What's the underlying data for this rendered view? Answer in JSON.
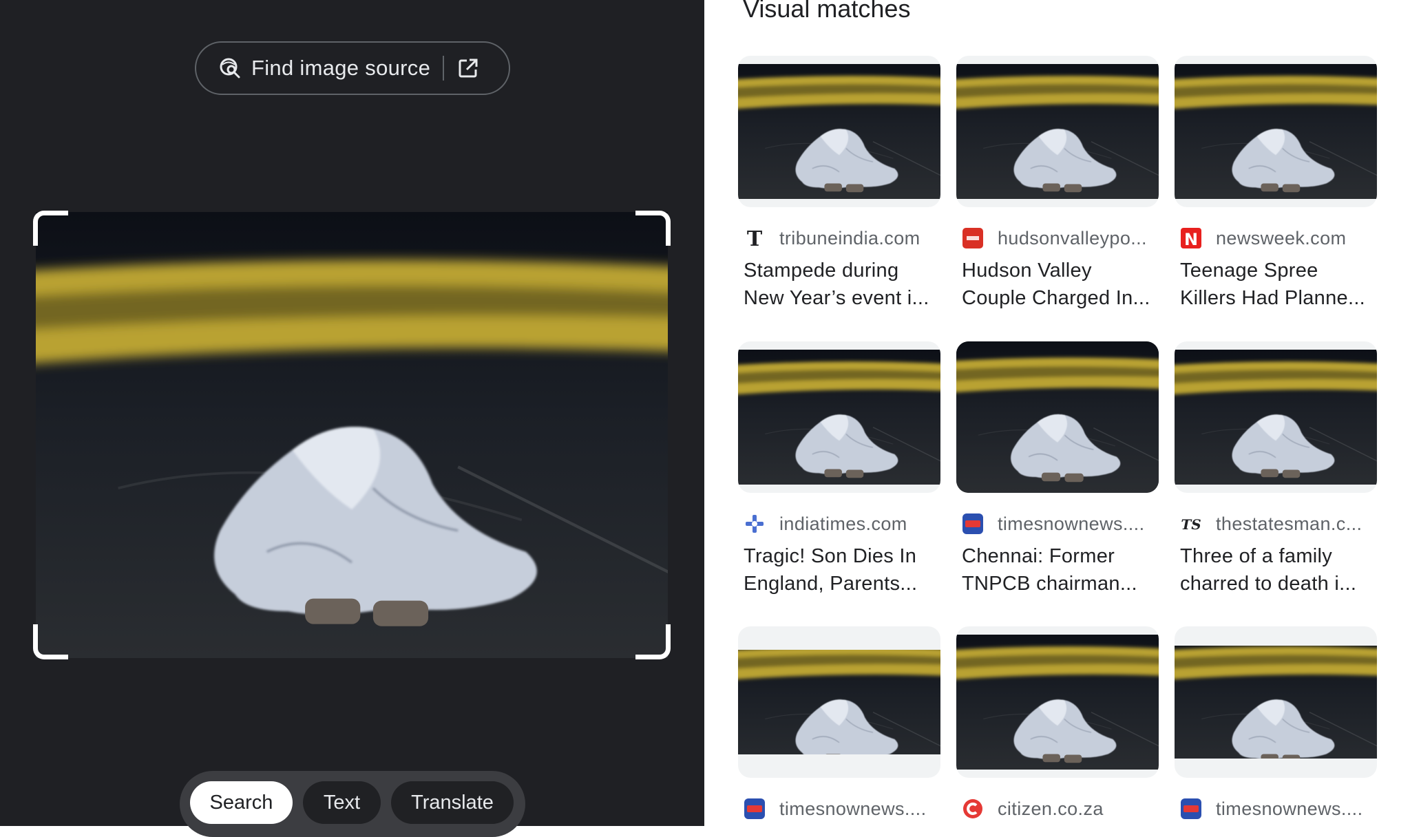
{
  "header": {
    "find_source_label": "Find image source",
    "lens_icon": "lens-search-icon",
    "external_icon": "open-external-icon"
  },
  "modes": {
    "items": [
      {
        "label": "Search",
        "active": true
      },
      {
        "label": "Text",
        "active": false
      },
      {
        "label": "Translate",
        "active": false
      }
    ]
  },
  "results": {
    "title": "Visual matches",
    "items": [
      {
        "source": "tribuneindia.com",
        "title_line1": "Stampede during",
        "title_line2": "New Year’s event i..."
      },
      {
        "source": "hudsonvalleypo...",
        "title_line1": "Hudson Valley",
        "title_line2": "Couple Charged In..."
      },
      {
        "source": "newsweek.com",
        "title_line1": "Teenage Spree",
        "title_line2": "Killers Had Planne..."
      },
      {
        "source": "indiatimes.com",
        "title_line1": "Tragic! Son Dies In",
        "title_line2": "England, Parents..."
      },
      {
        "source": "timesnownews....",
        "title_line1": "Chennai: Former",
        "title_line2": "TNPCB chairman..."
      },
      {
        "source": "thestatesman.c...",
        "title_line1": "Three of a family",
        "title_line2": "charred to death i..."
      },
      {
        "source": "timesnownews....",
        "title_line1": "",
        "title_line2": ""
      },
      {
        "source": "citizen.co.za",
        "title_line1": "",
        "title_line2": ""
      },
      {
        "source": "timesnownews....",
        "title_line1": "",
        "title_line2": ""
      }
    ]
  },
  "colors": {
    "left_bg": "#1f2024",
    "tape_yellow": "#c9b43a",
    "sheet": "#c9d1de"
  }
}
